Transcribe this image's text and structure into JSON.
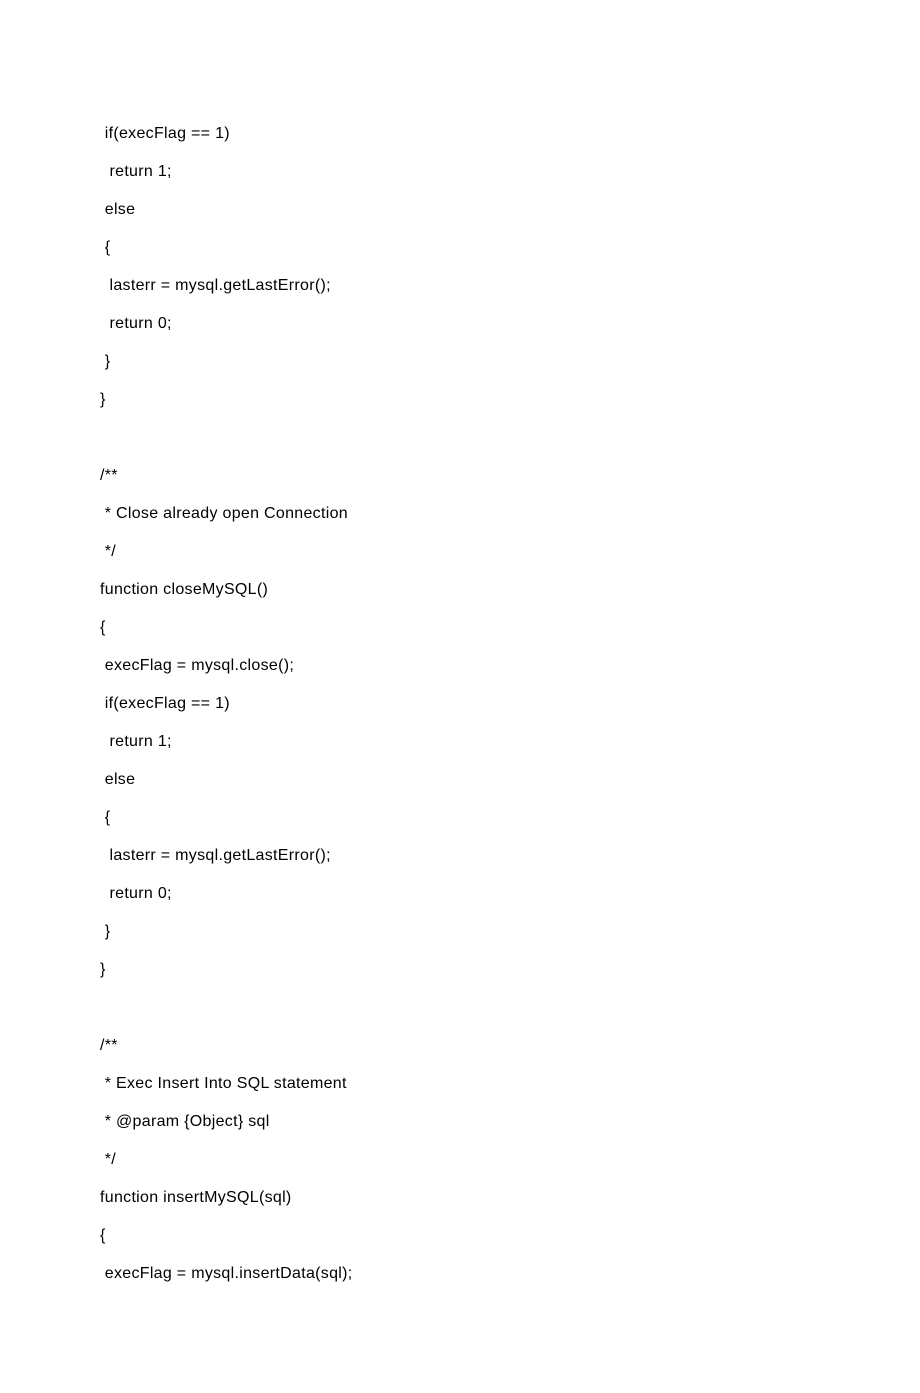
{
  "code": {
    "lines": [
      " if(execFlag == 1)",
      "  return 1;",
      " else",
      " {",
      "  lasterr = mysql.getLastError();",
      "  return 0;",
      " }",
      "}",
      "",
      "/**",
      " * Close already open Connection",
      " */",
      "function closeMySQL()",
      "{",
      " execFlag = mysql.close();",
      " if(execFlag == 1)",
      "  return 1;",
      " else",
      " {",
      "  lasterr = mysql.getLastError();",
      "  return 0;",
      " }",
      "}",
      "",
      "/**",
      " * Exec Insert Into SQL statement",
      " * @param {Object} sql",
      " */",
      "function insertMySQL(sql)",
      "{",
      " execFlag = mysql.insertData(sql);"
    ]
  }
}
